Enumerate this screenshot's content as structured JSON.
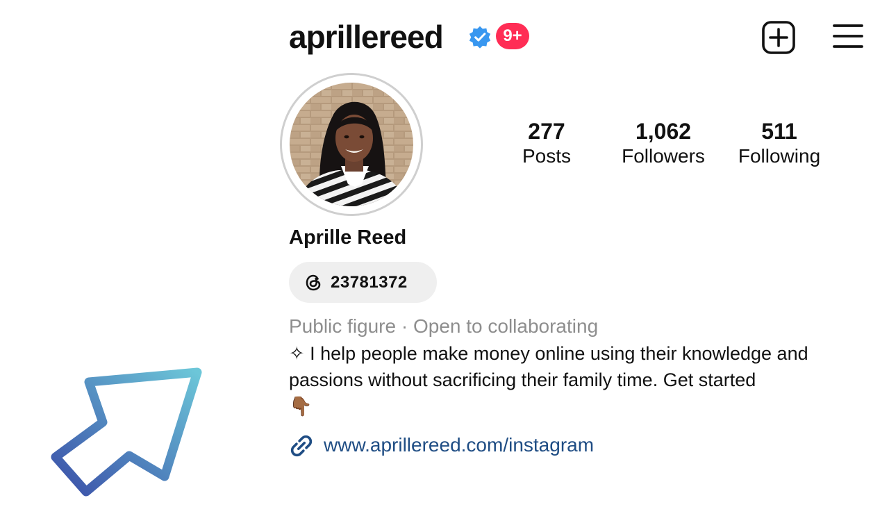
{
  "header": {
    "username": "aprillereed",
    "verified_icon": "verified-badge-icon",
    "notification_badge": "9+",
    "new_post_icon": "plus-square-icon",
    "menu_icon": "hamburger-menu-icon"
  },
  "profile": {
    "avatar_icon": "profile-photo",
    "stats": [
      {
        "value": "277",
        "label": "Posts"
      },
      {
        "value": "1,062",
        "label": "Followers"
      },
      {
        "value": "511",
        "label": "Following"
      }
    ],
    "full_name": "Aprille Reed",
    "threads": {
      "icon": "threads-icon",
      "label": "23781372"
    },
    "category": "Public figure · Open to collaborating",
    "bio": "✧ I help people make money online using their knowledge and passions without sacrificing their family time. Get started",
    "bio_emoji": "👇🏾",
    "link": {
      "icon": "link-icon",
      "text": "www.aprillereed.com/instagram"
    }
  },
  "decoration": {
    "arrow_icon": "arrow-up-right-icon"
  },
  "colors": {
    "notification": "#ff2d55",
    "verified": "#3897f0",
    "link": "#1f4d84",
    "secondary_text": "#8e8e8e",
    "pill_background": "#efefef",
    "arrow_gradient_start": "#3a4fa8",
    "arrow_gradient_end": "#6cc6d8"
  }
}
